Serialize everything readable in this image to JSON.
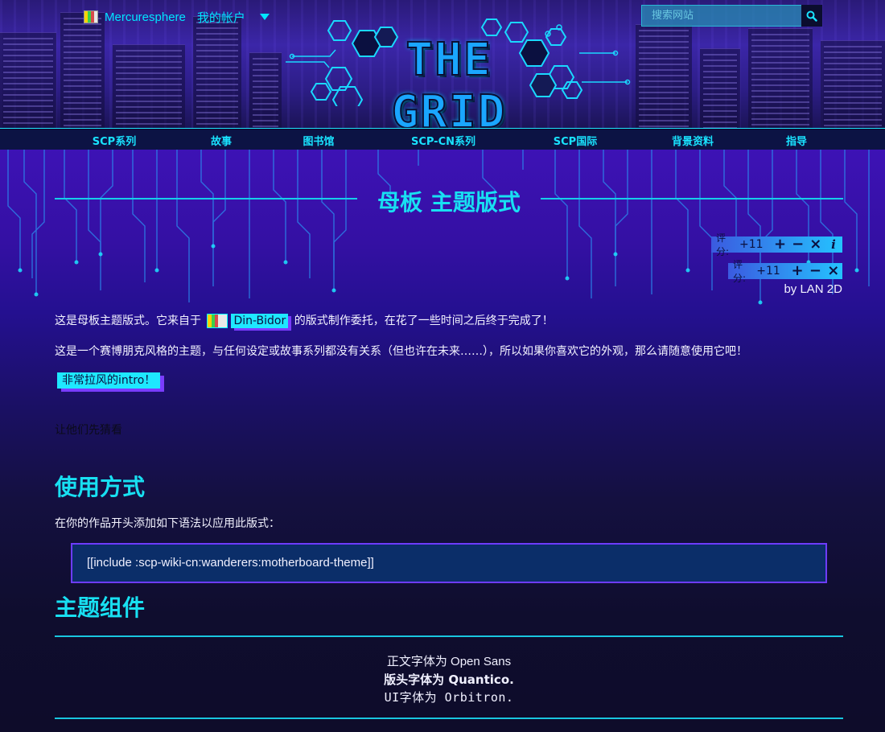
{
  "user": {
    "name": "Mercuresphere",
    "account_label": "我的帐户"
  },
  "search": {
    "placeholder": "搜索网站"
  },
  "logo": {
    "text": "THE GRID"
  },
  "nav": {
    "items": [
      "SCP系列",
      "故事",
      "图书馆",
      "SCP-CN系列",
      "SCP国际",
      "背景资料",
      "指导"
    ]
  },
  "page": {
    "title": "母板 主题版式",
    "byline": "by LAN 2D"
  },
  "rating": [
    {
      "label": "评分:",
      "value": "+11",
      "up": "+",
      "down": "−",
      "cancel": "×",
      "info": "i"
    },
    {
      "label": "评分:",
      "value": "+11",
      "up": "+",
      "down": "−",
      "cancel": "×"
    }
  ],
  "content": {
    "p1_before": "这是母板主题版式。它来自于",
    "author": "Din-Bidor",
    "p1_after": "的版式制作委托，在花了一些时间之后终于完成了！",
    "p2": "这是一个赛博朋克风格的主题，与任何设定或故事系列都没有关系（但也许在未来……），所以如果你喜欢它的外观，那么请随意使用它吧！",
    "intro_button": "非常拉风的intro！",
    "hidden_text": "让他们先猜看",
    "h_usage": "使用方式",
    "usage_text": "在你的作品开头添加如下语法以应用此版式：",
    "code": "[[include :scp-wiki-cn:wanderers:motherboard-theme]]",
    "h_components": "主题组件",
    "fonts": {
      "body": "正文字体为 Open Sans",
      "header": "版头字体为 Quantico.",
      "ui": "UI字体为 Orbitron."
    }
  },
  "colors": {
    "accent": "#18e0f2",
    "link_bg": "#1ee8ff",
    "shadow": "#7a3cff",
    "code_bg": "#0b2e69"
  },
  "icons": {
    "search": "search-icon",
    "caret": "chevron-down-icon"
  }
}
